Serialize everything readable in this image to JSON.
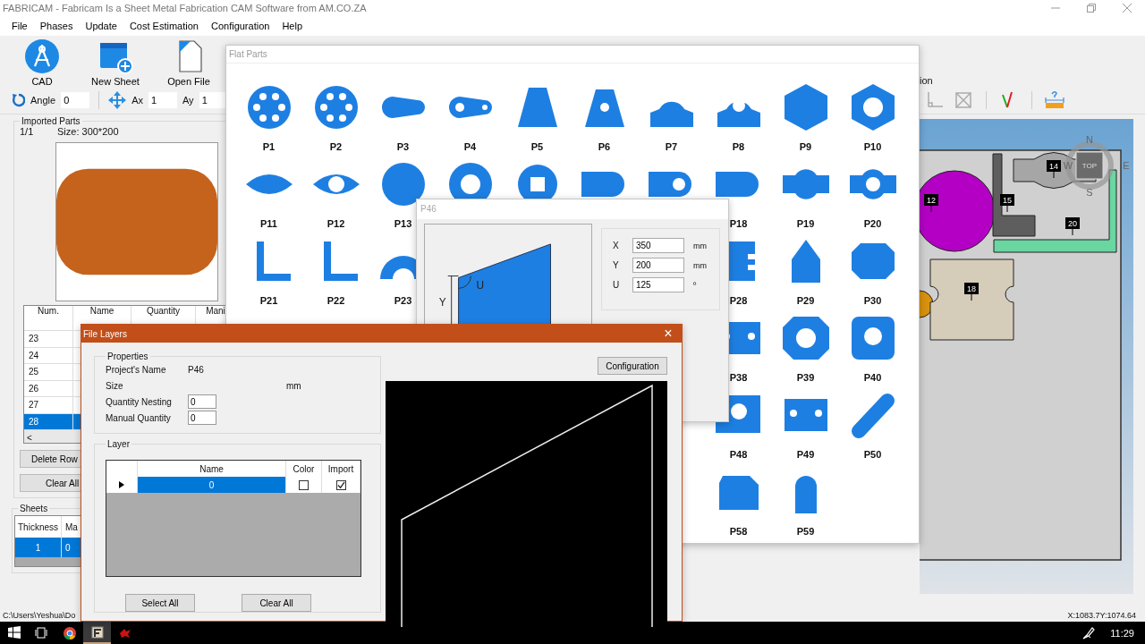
{
  "window": {
    "title": "FABRICAM - Fabricam Is a Sheet Metal Fabrication CAM Software from AM.CO.ZA"
  },
  "menu": [
    "File",
    "Phases",
    "Update",
    "Cost Estimation",
    "Configuration",
    "Help"
  ],
  "toolbar": {
    "buttons": [
      {
        "kind": "cad",
        "label": "CAD"
      },
      {
        "kind": "new-sheet",
        "label": "New Sheet"
      },
      {
        "kind": "open-file",
        "label": "Open File"
      }
    ],
    "transform": [
      {
        "kind": "rotate",
        "label": "Angle",
        "value": "0"
      },
      {
        "kind": "move",
        "label": "Ax",
        "value": "1"
      },
      {
        "kind": "plain",
        "label": "Ay",
        "value": "1"
      }
    ],
    "right_caption": "ion",
    "right_tools": [
      {
        "kind": "axes"
      },
      {
        "kind": "crossed-box"
      },
      {
        "kind": "check"
      },
      {
        "kind": "measure"
      }
    ]
  },
  "imported_parts": {
    "title": "Imported Parts",
    "page": "1/1",
    "size": "Size: 300*200",
    "columns": [
      "Num.",
      "Name",
      "Quantity",
      "Mani"
    ],
    "rows": [
      {
        "num": "23",
        "selected": false
      },
      {
        "num": "24",
        "selected": false
      },
      {
        "num": "25",
        "selected": false
      },
      {
        "num": "26",
        "selected": false
      },
      {
        "num": "27",
        "selected": false
      },
      {
        "num": "28",
        "selected": true
      }
    ],
    "scroll_left": "<",
    "buttons": [
      "Delete Row",
      "Clear All"
    ]
  },
  "sheets": {
    "title": "Sheets",
    "columns": [
      "Thickness",
      "Ma"
    ],
    "rows": [
      {
        "cells": [
          "1",
          "0"
        ],
        "selected": true
      }
    ]
  },
  "nesting_view": {
    "pieces": [
      {
        "kind": "disc",
        "label": "12",
        "color": "#b400c4"
      },
      {
        "kind": "half-disc",
        "color": "#d8920e"
      },
      {
        "kind": "dogbone",
        "label": "14",
        "color": "#a6a6a6"
      },
      {
        "kind": "angle-dark",
        "label": "15",
        "color": "#5e5e5e"
      },
      {
        "kind": "angle-green",
        "label": "20",
        "color": "#6ad6a2"
      },
      {
        "kind": "puzzle",
        "label": "18",
        "color": "#d6ccba"
      }
    ],
    "view_cube": {
      "top": "TOP",
      "north": "N",
      "east": "E",
      "south": "S",
      "west": "W"
    }
  },
  "status_bar": {
    "path": "C:\\Users\\Yeshua\\Do",
    "coords": "X:1083.7Y:1074.64"
  },
  "flat_parts": {
    "title": "Flat Parts",
    "rows": [
      [
        {
          "label": "P1",
          "kind": "disc-holes"
        },
        {
          "label": "P2",
          "kind": "disc-holes"
        },
        {
          "label": "P3",
          "kind": "slot"
        },
        {
          "label": "P4",
          "kind": "slot-holes"
        },
        {
          "label": "P5",
          "kind": "trapezoid"
        },
        {
          "label": "P6",
          "kind": "trapezoid-hole"
        },
        {
          "label": "P7",
          "kind": "lug"
        },
        {
          "label": "P8",
          "kind": "lug-hole"
        },
        {
          "label": "P9",
          "kind": "hexagon"
        },
        {
          "label": "P10",
          "kind": "hexagon-hole"
        }
      ],
      [
        {
          "label": "P11",
          "kind": "lens"
        },
        {
          "label": "P12",
          "kind": "lens-hole"
        },
        {
          "label": "P13",
          "kind": "circle"
        },
        {
          "kind": "ring"
        },
        {
          "kind": "circle-square"
        },
        {
          "kind": "rect-round"
        },
        {
          "kind": "rect-round-hole"
        },
        {
          "label": "P18",
          "kind": "rect-round"
        },
        {
          "label": "P19",
          "kind": "bulge"
        },
        {
          "label": "P20",
          "kind": "bulge-hole"
        }
      ],
      [
        {
          "label": "P21",
          "kind": "angle"
        },
        {
          "label": "P22",
          "kind": "angle"
        },
        {
          "label": "P23",
          "kind": "sector"
        },
        null,
        null,
        null,
        null,
        {
          "label": "P28",
          "kind": "rect-notch"
        },
        {
          "label": "P29",
          "kind": "pentagon"
        },
        {
          "label": "P30",
          "kind": "octagon"
        }
      ],
      [
        null,
        null,
        null,
        null,
        null,
        null,
        null,
        {
          "label": "P38",
          "kind": "rect-holes"
        },
        {
          "label": "P39",
          "kind": "octagon-hole"
        },
        {
          "label": "P40",
          "kind": "rounded-hole"
        }
      ],
      [
        null,
        null,
        null,
        null,
        null,
        null,
        null,
        {
          "label": "P48",
          "kind": "step-hole"
        },
        {
          "label": "P49",
          "kind": "rect-holes"
        },
        {
          "label": "P50",
          "kind": "diagonal-slot"
        }
      ],
      [
        null,
        null,
        null,
        null,
        null,
        null,
        null,
        {
          "label": "P58",
          "kind": "chamfer"
        },
        {
          "label": "P59",
          "kind": "arch"
        },
        null
      ]
    ]
  },
  "part_dialog": {
    "title": "P46",
    "axis_labels": [
      "Y",
      "U"
    ],
    "fields": [
      {
        "label": "X",
        "value": "350",
        "unit": "mm"
      },
      {
        "label": "Y",
        "value": "200",
        "unit": "mm"
      },
      {
        "label": "U",
        "value": "125",
        "unit": "º"
      }
    ]
  },
  "file_layers": {
    "title": "File Layers",
    "close": "×",
    "properties_title": "Properties",
    "properties": [
      {
        "kind": "text",
        "label": "Project's Name",
        "value": "P46"
      },
      {
        "kind": "unit",
        "label": "Size",
        "value": "mm"
      },
      {
        "kind": "input",
        "label": "Quantity  Nesting",
        "value": "0"
      },
      {
        "kind": "input",
        "label": "Manual Quantity",
        "value": "0"
      }
    ],
    "layer_title": "Layer",
    "layer_columns": [
      "Name",
      "Color",
      "Import"
    ],
    "layers": [
      {
        "name": "0",
        "selected": true,
        "color_checked": false,
        "import": true
      }
    ],
    "buttons": [
      "Select All",
      "Clear All"
    ],
    "config_button": "Configuration"
  },
  "taskbar": {
    "apps": [
      {
        "kind": "start",
        "active": false
      },
      {
        "kind": "task-view",
        "active": false
      },
      {
        "kind": "browser",
        "active": false
      },
      {
        "kind": "fabricam",
        "active": true
      },
      {
        "kind": "red-app",
        "active": false
      }
    ],
    "time": "11:29"
  }
}
